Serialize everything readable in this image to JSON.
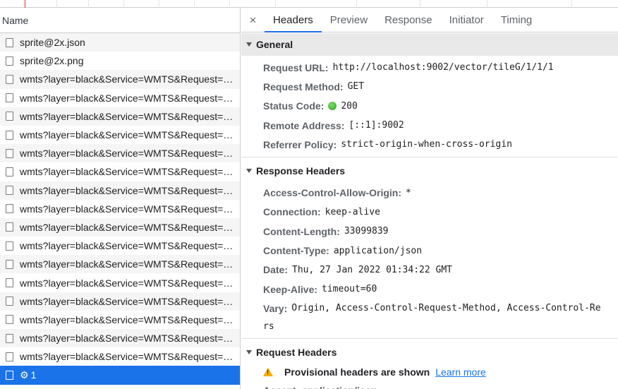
{
  "left": {
    "column_header": "Name",
    "rows": [
      "sprite@2x.json",
      "sprite@2x.png",
      "wmts?layer=black&Service=WMTS&Request=GetTile",
      "wmts?layer=black&Service=WMTS&Request=GetTile",
      "wmts?layer=black&Service=WMTS&Request=GetTile",
      "wmts?layer=black&Service=WMTS&Request=GetTile",
      "wmts?layer=black&Service=WMTS&Request=GetTile",
      "wmts?layer=black&Service=WMTS&Request=GetTile",
      "wmts?layer=black&Service=WMTS&Request=GetTile",
      "wmts?layer=black&Service=WMTS&Request=GetTile",
      "wmts?layer=black&Service=WMTS&Request=GetTile",
      "wmts?layer=black&Service=WMTS&Request=GetTile",
      "wmts?layer=black&Service=WMTS&Request=GetTile",
      "wmts?layer=black&Service=WMTS&Request=GetTile",
      "wmts?layer=black&Service=WMTS&Request=GetTile",
      "wmts?layer=black&Service=WMTS&Request=GetTile",
      "wmts?layer=black&Service=WMTS&Request=GetTile",
      "wmts?layer=black&Service=WMTS&Request=GetTile"
    ],
    "selected_row": {
      "icon": "gear-icon",
      "glyph": "⚙",
      "label": "1"
    }
  },
  "tabs": {
    "close_glyph": "×",
    "items": [
      "Headers",
      "Preview",
      "Response",
      "Initiator",
      "Timing"
    ],
    "active": "Headers"
  },
  "general": {
    "title": "General",
    "request_url_label": "Request URL:",
    "request_url": "http://localhost:9002/vector/tileG/1/1/1",
    "request_method_label": "Request Method:",
    "request_method": "GET",
    "status_code_label": "Status Code:",
    "status_code": "200",
    "status_color": "#34a853",
    "remote_address_label": "Remote Address:",
    "remote_address": "[::1]:9002",
    "referrer_policy_label": "Referrer Policy:",
    "referrer_policy": "strict-origin-when-cross-origin"
  },
  "response_headers": {
    "title": "Response Headers",
    "items": [
      {
        "key": "Access-Control-Allow-Origin:",
        "value": "*"
      },
      {
        "key": "Connection:",
        "value": "keep-alive"
      },
      {
        "key": "Content-Length:",
        "value": "33099839"
      },
      {
        "key": "Content-Type:",
        "value": "application/json"
      },
      {
        "key": "Date:",
        "value": "Thu, 27 Jan 2022 01:34:22 GMT"
      },
      {
        "key": "Keep-Alive:",
        "value": "timeout=60"
      },
      {
        "key": "Vary:",
        "value": "Origin, Access-Control-Request-Method, Access-Control-Re"
      }
    ],
    "vary_wrap": "rs"
  },
  "request_headers": {
    "title": "Request Headers",
    "provisional_message": "Provisional headers are shown",
    "learn_more": "Learn more",
    "partial_next": "Accept: application/json"
  },
  "colors": {
    "accent": "#1a73e8",
    "selected_row_bg": "#1a73e8",
    "warning": "#f9ab00"
  }
}
